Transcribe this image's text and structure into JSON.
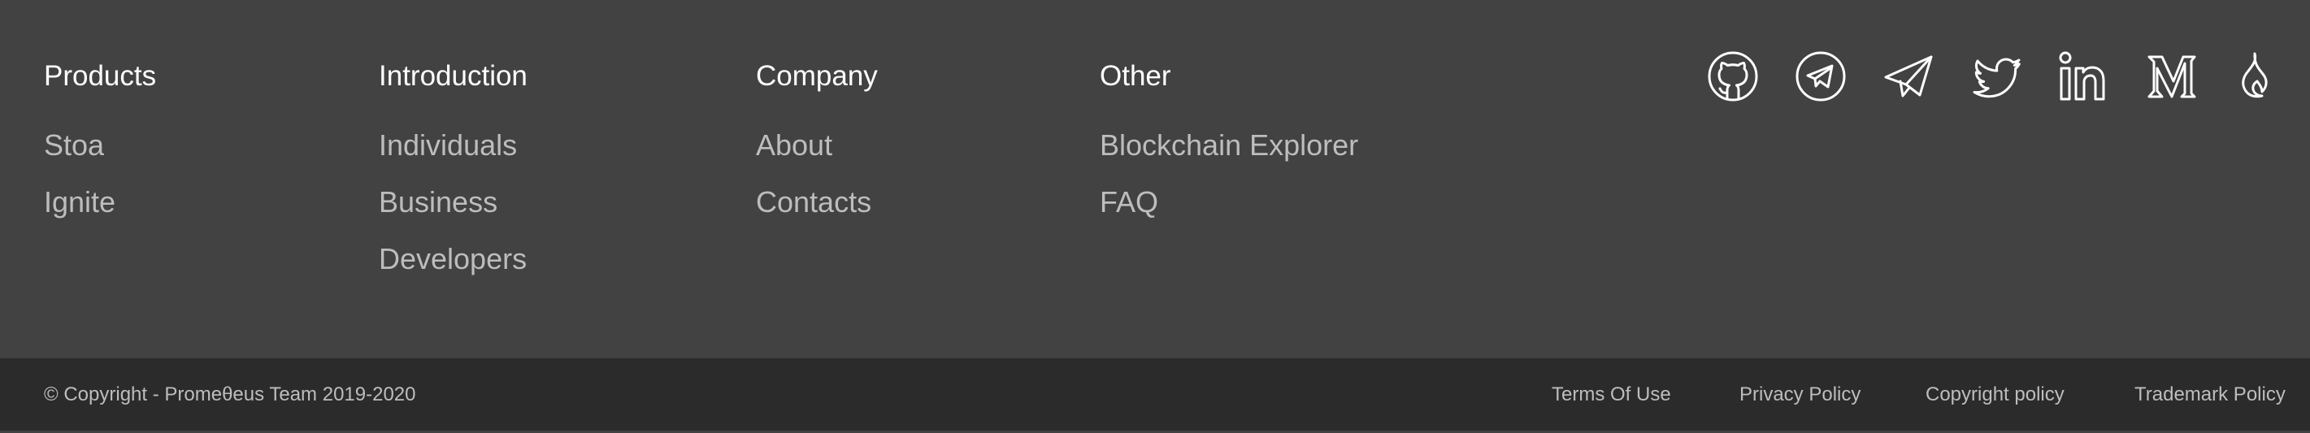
{
  "columns": {
    "products": {
      "title": "Products",
      "links": [
        "Stoa",
        "Ignite"
      ]
    },
    "introduction": {
      "title": "Introduction",
      "links": [
        "Individuals",
        "Business",
        "Developers"
      ]
    },
    "company": {
      "title": "Company",
      "links": [
        "About",
        "Contacts"
      ]
    },
    "other": {
      "title": "Other",
      "links": [
        "Blockchain Explorer",
        "FAQ"
      ]
    }
  },
  "social_icons": [
    "github-icon",
    "telegram-icon",
    "paper-plane-icon",
    "twitter-icon",
    "linkedin-icon",
    "medium-icon",
    "flame-icon"
  ],
  "bottom": {
    "copyright": "© Copyright - Promeθeus Team 2019-2020",
    "links": [
      "Terms Of Use",
      "Privacy Policy",
      "Copyright policy",
      "Trademark Policy"
    ]
  },
  "colors": {
    "footer_bg": "#424242",
    "bottom_bar_bg": "#2b2b2b",
    "heading": "#ffffff",
    "link": "#bdbdbd"
  }
}
